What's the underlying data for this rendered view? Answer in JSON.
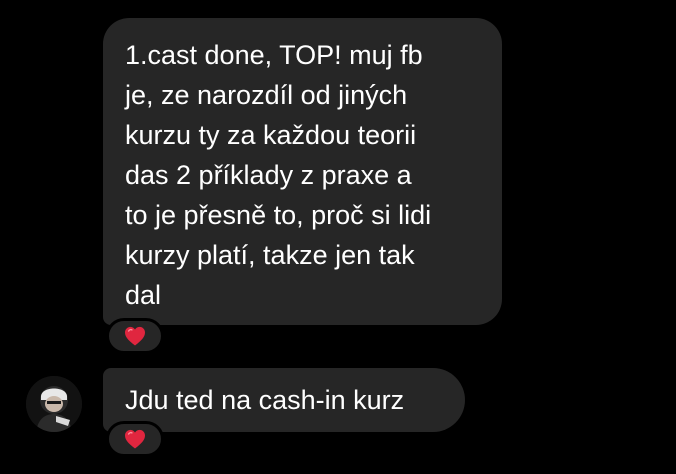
{
  "messages": [
    {
      "lines": [
        "1.cast done, TOP! muj fb",
        "je, ze narozdíl od jiných",
        "kurzu ty za každou teorii",
        "das 2 příklady z praxe a",
        "to je přesně to, proč si lidi",
        "kurzy platí, takze jen tak",
        "dal"
      ],
      "reaction": "heart"
    },
    {
      "lines": [
        "Jdu ted na cash-in kurz"
      ],
      "reaction": "heart"
    }
  ],
  "colors": {
    "background": "#000000",
    "bubble": "#262626",
    "text": "#ffffff",
    "heart": "#e0263f"
  }
}
